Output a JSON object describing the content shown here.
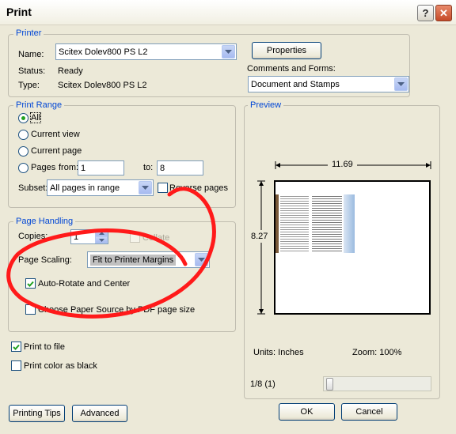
{
  "window": {
    "title": "Print"
  },
  "printer": {
    "group_label": "Printer",
    "name_label": "Name:",
    "name_value": "Scitex Dolev800 PS L2",
    "status_label": "Status:",
    "status_value": "Ready",
    "type_label": "Type:",
    "type_value": "Scitex Dolev800 PS L2",
    "properties_label": "Properties",
    "comments_label": "Comments and Forms:",
    "comments_value": "Document and Stamps"
  },
  "print_range": {
    "group_label": "Print Range",
    "all_label": "All",
    "current_view_label": "Current view",
    "current_page_label": "Current page",
    "pages_label": "Pages",
    "from_label": "from:",
    "from_value": "1",
    "to_label": "to:",
    "to_value": "8",
    "subset_label": "Subset:",
    "subset_value": "All pages in range",
    "reverse_label": "Reverse pages"
  },
  "page_handling": {
    "group_label": "Page Handling",
    "copies_label": "Copies:",
    "copies_value": "1",
    "collate_label": "Collate",
    "scaling_label": "Page Scaling:",
    "scaling_value": "Fit to Printer Margins",
    "autorotate_label": "Auto-Rotate and Center",
    "choose_paper_label": "Choose Paper Source by PDF page size"
  },
  "options": {
    "print_to_file_label": "Print to file",
    "print_color_black_label": "Print color as black"
  },
  "preview": {
    "group_label": "Preview",
    "width_value": "11.69",
    "height_value": "8.27",
    "units_text": "Units: Inches",
    "zoom_text": "Zoom: 100%",
    "page_indicator": "1/8 (1)"
  },
  "buttons": {
    "printing_tips": "Printing Tips",
    "advanced": "Advanced",
    "ok": "OK",
    "cancel": "Cancel"
  },
  "annotation": {
    "color": "#ff1a1a"
  }
}
